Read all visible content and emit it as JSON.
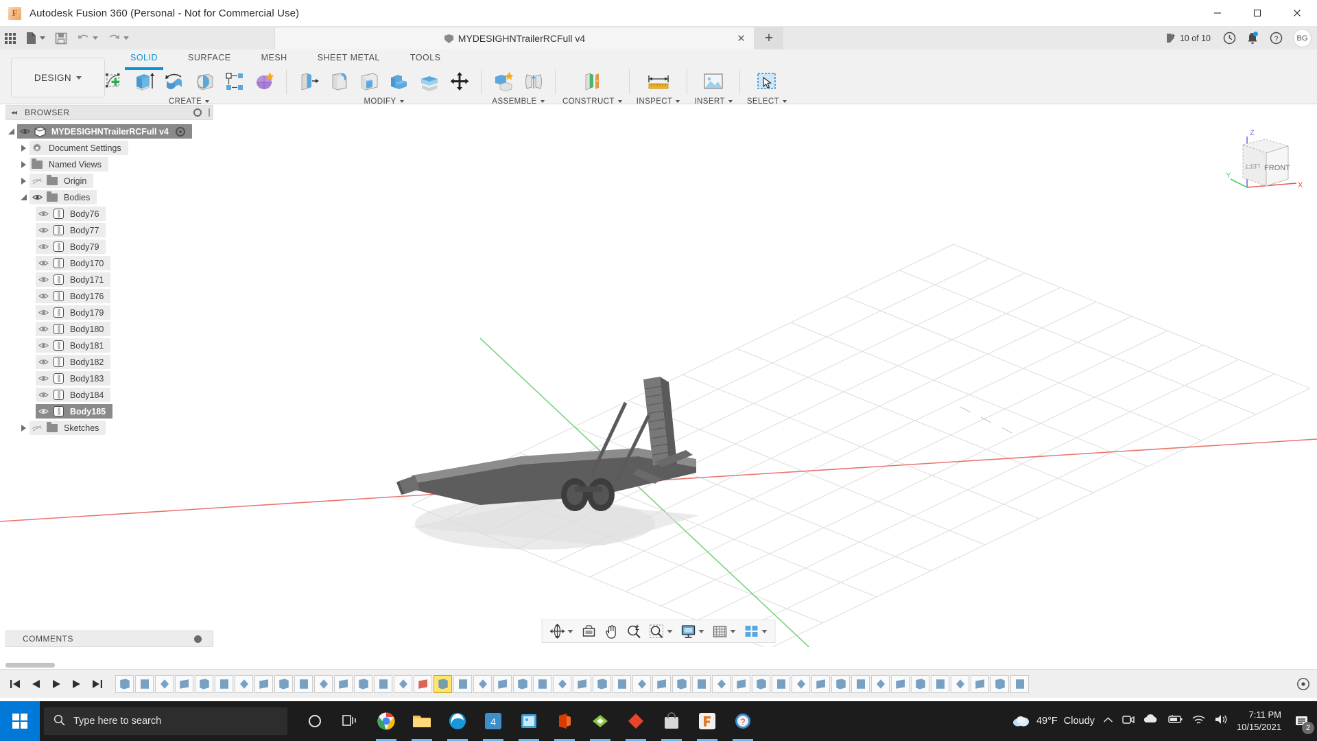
{
  "window": {
    "title": "Autodesk Fusion 360 (Personal - Not for Commercial Use)",
    "logo_letter": "F",
    "minimize": "—",
    "maximize": "☐",
    "close": "✕"
  },
  "quick_access": {
    "items": [
      {
        "name": "app-grid",
        "label": "Grid"
      },
      {
        "name": "new-file",
        "label": "New"
      },
      {
        "name": "save",
        "label": "Save"
      },
      {
        "name": "undo",
        "label": "Undo"
      },
      {
        "name": "redo",
        "label": "Redo"
      }
    ]
  },
  "document_tab": {
    "label": "MYDESIGHNTrailerRCFull v4",
    "close_glyph": "✕",
    "add_tab_glyph": "+"
  },
  "header_right": {
    "jobs_status": "10 of 10",
    "avatar_initials": "BG",
    "history_icon": "clock-icon",
    "notification_icon": "bell-icon",
    "help_icon": "help-icon"
  },
  "ribbon": {
    "workspace": "DESIGN",
    "workspace_caret": "▾",
    "tabs": [
      {
        "label": "SOLID",
        "active": true
      },
      {
        "label": "SURFACE",
        "active": false
      },
      {
        "label": "MESH",
        "active": false
      },
      {
        "label": "SHEET METAL",
        "active": false
      },
      {
        "label": "TOOLS",
        "active": false
      }
    ],
    "groups": [
      {
        "label": "CREATE",
        "has_caret": true,
        "icons": [
          "create-sketch-icon",
          "extrude-icon",
          "revolve-icon",
          "sweep-icon",
          "pattern-icon",
          "form-icon"
        ]
      },
      {
        "label": "MODIFY",
        "has_caret": true,
        "icons": [
          "press-pull-icon",
          "fillet-icon",
          "shell-icon",
          "combine-icon",
          "offset-face-icon",
          "move-copy-icon"
        ]
      },
      {
        "label": "ASSEMBLE",
        "has_caret": true,
        "icons": [
          "new-component-icon",
          "joint-icon"
        ]
      },
      {
        "label": "CONSTRUCT",
        "has_caret": true,
        "icons": [
          "offset-plane-icon"
        ]
      },
      {
        "label": "INSPECT",
        "has_caret": true,
        "icons": [
          "measure-icon"
        ]
      },
      {
        "label": "INSERT",
        "has_caret": true,
        "icons": [
          "insert-mcmaster-icon"
        ]
      },
      {
        "label": "SELECT",
        "has_caret": true,
        "icons": [
          "select-window-icon"
        ]
      }
    ]
  },
  "browser": {
    "title": "BROWSER",
    "collapse_glyph": "◂◂",
    "tree": [
      {
        "label": "MYDESIGHNTrailerRCFull v4",
        "type": "component",
        "depth": 0,
        "expander": "open",
        "eye": true,
        "selected": true,
        "has_target": true
      },
      {
        "label": "Document Settings",
        "type": "settings",
        "depth": 1,
        "expander": "closed",
        "eye": false
      },
      {
        "label": "Named Views",
        "type": "folder",
        "depth": 1,
        "expander": "closed",
        "eye": false
      },
      {
        "label": "Origin",
        "type": "folder",
        "depth": 1,
        "expander": "closed",
        "eye": true,
        "eye_off": true
      },
      {
        "label": "Bodies",
        "type": "folder",
        "depth": 1,
        "expander": "open",
        "eye": true
      },
      {
        "label": "Body76",
        "type": "body",
        "depth": 2,
        "eye": true
      },
      {
        "label": "Body77",
        "type": "body",
        "depth": 2,
        "eye": true
      },
      {
        "label": "Body79",
        "type": "body",
        "depth": 2,
        "eye": true
      },
      {
        "label": "Body170",
        "type": "body",
        "depth": 2,
        "eye": true
      },
      {
        "label": "Body171",
        "type": "body",
        "depth": 2,
        "eye": true
      },
      {
        "label": "Body176",
        "type": "body",
        "depth": 2,
        "eye": true
      },
      {
        "label": "Body179",
        "type": "body",
        "depth": 2,
        "eye": true
      },
      {
        "label": "Body180",
        "type": "body",
        "depth": 2,
        "eye": true
      },
      {
        "label": "Body181",
        "type": "body",
        "depth": 2,
        "eye": true
      },
      {
        "label": "Body182",
        "type": "body",
        "depth": 2,
        "eye": true
      },
      {
        "label": "Body183",
        "type": "body",
        "depth": 2,
        "eye": true
      },
      {
        "label": "Body184",
        "type": "body",
        "depth": 2,
        "eye": true
      },
      {
        "label": "Body185",
        "type": "body",
        "depth": 2,
        "eye": true,
        "selected": true
      },
      {
        "label": "Sketches",
        "type": "folder",
        "depth": 1,
        "expander": "closed",
        "eye": true,
        "eye_off": true
      }
    ]
  },
  "comments": {
    "label": "COMMENTS"
  },
  "viewcube": {
    "face_label": "FRONT",
    "side_label": "LEFT",
    "axis_x": "X",
    "axis_y": "Y",
    "axis_z": "Z",
    "axis_x_color": "#e8524a",
    "axis_y_color": "#4bcf62",
    "axis_z_color": "#6e6ee0"
  },
  "nav_bar": {
    "items": [
      {
        "name": "orbit-icon",
        "caret": true
      },
      {
        "name": "look-at-icon",
        "caret": false
      },
      {
        "name": "pan-icon",
        "caret": false
      },
      {
        "name": "zoom-icon",
        "caret": false
      },
      {
        "name": "zoom-window-icon",
        "caret": true
      },
      {
        "name": "display-settings-icon",
        "caret": true
      },
      {
        "name": "grid-snaps-icon",
        "caret": true
      },
      {
        "name": "viewports-icon",
        "caret": true
      }
    ]
  },
  "timeline": {
    "playback": [
      "skip-to-start-icon",
      "step-back-icon",
      "play-icon",
      "step-forward-icon",
      "skip-to-end-icon"
    ],
    "feature_count": 46,
    "selected_feature_index": 16,
    "error_feature_index": 15,
    "end_marker": "timeline-settings-icon"
  },
  "taskbar": {
    "search_placeholder": "Type here to search",
    "weather_temp": "49°F",
    "weather_desc": "Cloudy",
    "time": "7:11 PM",
    "date": "10/15/2021",
    "notification_count": "2",
    "apps": [
      {
        "name": "cortana-icon",
        "active": false
      },
      {
        "name": "task-view-icon",
        "active": false
      },
      {
        "name": "chrome-icon",
        "active": true
      },
      {
        "name": "file-explorer-icon",
        "active": true
      },
      {
        "name": "edge-icon",
        "active": true
      },
      {
        "name": "app-badge-4-icon",
        "badge": "4",
        "active": true
      },
      {
        "name": "photos-icon",
        "active": true
      },
      {
        "name": "office-icon",
        "active": true
      },
      {
        "name": "app-green-icon",
        "active": true
      },
      {
        "name": "diamond-icon",
        "active": true
      },
      {
        "name": "store-icon",
        "active": true
      },
      {
        "name": "fusion360-icon",
        "active": true
      },
      {
        "name": "help-circle-icon",
        "active": true
      }
    ]
  }
}
